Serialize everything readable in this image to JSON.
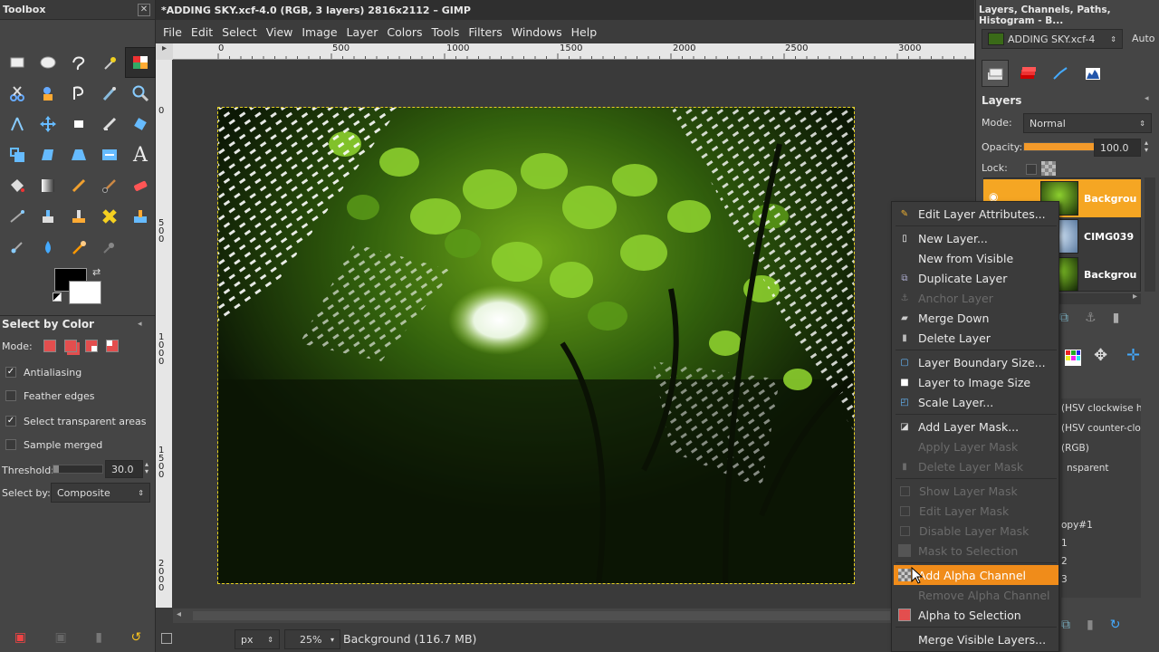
{
  "toolbox": {
    "title": "Toolbox",
    "options_title": "Select by Color",
    "mode_label": "Mode:",
    "antialiasing": "Antialiasing",
    "feather_edges": "Feather edges",
    "select_transparent": "Select transparent areas",
    "sample_merged": "Sample merged",
    "threshold_label": "Threshold:",
    "threshold_value": "30.0",
    "select_by_label": "Select by:",
    "select_by_value": "Composite"
  },
  "main": {
    "title": "*ADDING SKY.xcf-4.0 (RGB, 3 layers) 2816x2112 – GIMP",
    "menu": [
      "File",
      "Edit",
      "Select",
      "View",
      "Image",
      "Layer",
      "Colors",
      "Tools",
      "Filters",
      "Windows",
      "Help"
    ],
    "ruler_h": [
      "0",
      "500",
      "1000",
      "1500",
      "2000",
      "2500",
      "3000"
    ],
    "ruler_v": [
      "0",
      "5\n0\n0",
      "1\n0\n0\n0",
      "1\n5\n0\n0",
      "2\n0\n0\n0"
    ],
    "unit": "px",
    "zoom": "25%",
    "status": "Background (116.7 MB)"
  },
  "dock": {
    "title": "Layers, Channels, Paths, Histogram - B...",
    "image_name": "ADDING SKY.xcf-4",
    "auto_label": "Auto",
    "layers_title": "Layers",
    "mode_label": "Mode:",
    "mode_value": "Normal",
    "opacity_label": "Opacity:",
    "opacity_value": "100.0",
    "opacity_fraction": 1.0,
    "lock_label": "Lock:",
    "layers": [
      "Backgrou",
      "CIMG039",
      "Backgrou"
    ],
    "history": [
      "(HSV clockwise hu",
      "(HSV counter-cloc",
      "(RGB)",
      "nsparent",
      "opy#1",
      "1",
      "2",
      "3"
    ]
  },
  "context_menu": {
    "items": [
      {
        "label": "Edit Layer Attributes...",
        "enabled": true
      },
      {
        "label": "New Layer...",
        "enabled": true
      },
      {
        "label": "New from Visible",
        "enabled": true
      },
      {
        "label": "Duplicate Layer",
        "enabled": true
      },
      {
        "label": "Anchor Layer",
        "enabled": false
      },
      {
        "label": "Merge Down",
        "enabled": true
      },
      {
        "label": "Delete Layer",
        "enabled": true
      },
      {
        "label": "Layer Boundary Size...",
        "enabled": true
      },
      {
        "label": "Layer to Image Size",
        "enabled": true
      },
      {
        "label": "Scale Layer...",
        "enabled": true
      },
      {
        "label": "Add Layer Mask...",
        "enabled": true
      },
      {
        "label": "Apply Layer Mask",
        "enabled": false
      },
      {
        "label": "Delete Layer Mask",
        "enabled": false
      },
      {
        "label": "Show Layer Mask",
        "enabled": false
      },
      {
        "label": "Edit Layer Mask",
        "enabled": false
      },
      {
        "label": "Disable Layer Mask",
        "enabled": false
      },
      {
        "label": "Mask to Selection",
        "enabled": false
      },
      {
        "label": "Add Alpha Channel",
        "enabled": true,
        "highlighted": true
      },
      {
        "label": "Remove Alpha Channel",
        "enabled": false
      },
      {
        "label": "Alpha to Selection",
        "enabled": true
      },
      {
        "label": "Merge Visible Layers...",
        "enabled": true
      }
    ]
  }
}
